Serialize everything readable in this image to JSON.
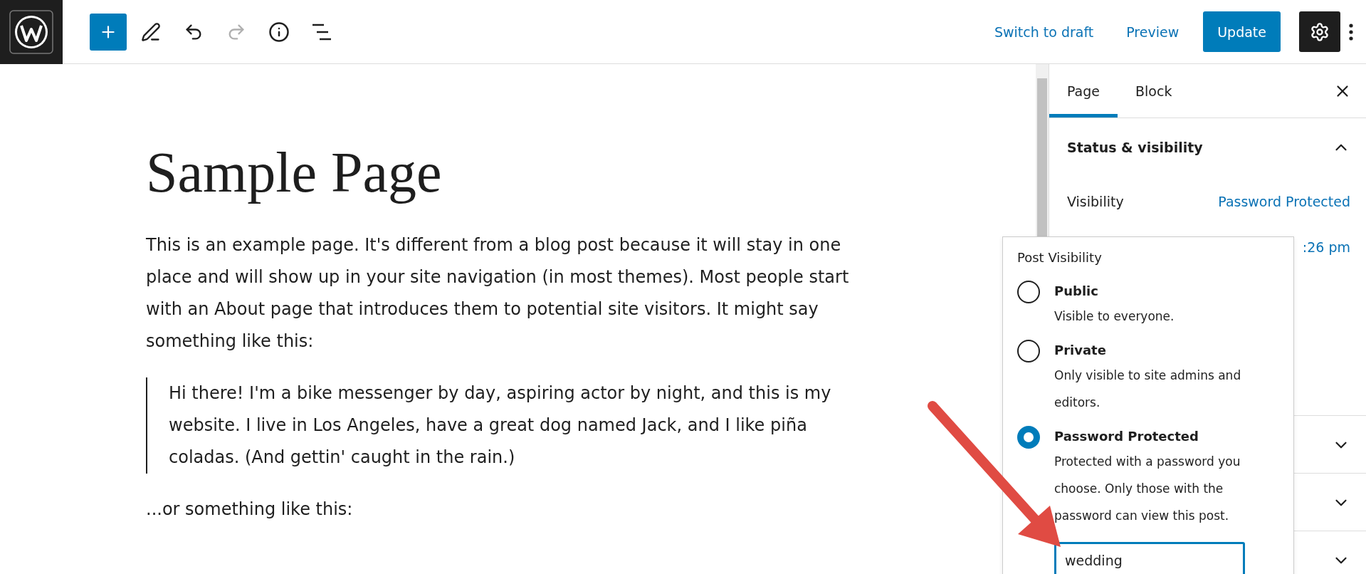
{
  "toolbar": {
    "tools": [
      {
        "kind": "add",
        "disabled": false
      },
      {
        "kind": "edit",
        "disabled": false
      },
      {
        "kind": "undo",
        "disabled": false
      },
      {
        "kind": "redo",
        "disabled": true
      },
      {
        "kind": "info",
        "disabled": false
      },
      {
        "kind": "list",
        "disabled": false
      }
    ],
    "switch_to_draft": "Switch to draft",
    "preview": "Preview",
    "update": "Update",
    "settings_active": true
  },
  "editor": {
    "title": "Sample Page",
    "blocks": [
      {
        "kind": "paragraph",
        "text": "This is an example page. It's different from a blog post because it will stay in one place and will show up in your site navigation (in most themes). Most people start with an About page that introduces them to potential site visitors. It might say something like this:"
      },
      {
        "kind": "quote",
        "text": "Hi there! I'm a bike messenger by day, aspiring actor by night, and this is my website. I live in Los Angeles, have a great dog named Jack, and I like piña coladas. (And gettin' caught in the rain.)"
      },
      {
        "kind": "paragraph",
        "text": "...or something like this:"
      }
    ]
  },
  "sidebar": {
    "tabs": [
      {
        "label": "Page",
        "selected": true
      },
      {
        "label": "Block",
        "selected": false
      }
    ],
    "panels": [
      {
        "title": "Status & visibility",
        "expanded": true,
        "rows": [
          {
            "label": "Visibility",
            "value": "Password Protected"
          },
          {
            "value": ":26 pm"
          }
        ]
      },
      {
        "expanded": false
      },
      {
        "expanded": false
      },
      {
        "expanded": false
      }
    ]
  },
  "popover": {
    "title": "Post Visibility",
    "options": [
      {
        "label": "Public",
        "description": "Visible to everyone.",
        "selected": false
      },
      {
        "label": "Private",
        "description": "Only visible to site admins and editors.",
        "selected": false
      },
      {
        "label": "Password Protected",
        "description": "Protected with a password you choose. Only those with the password can view this post.",
        "selected": true
      }
    ],
    "password": "wedding"
  }
}
